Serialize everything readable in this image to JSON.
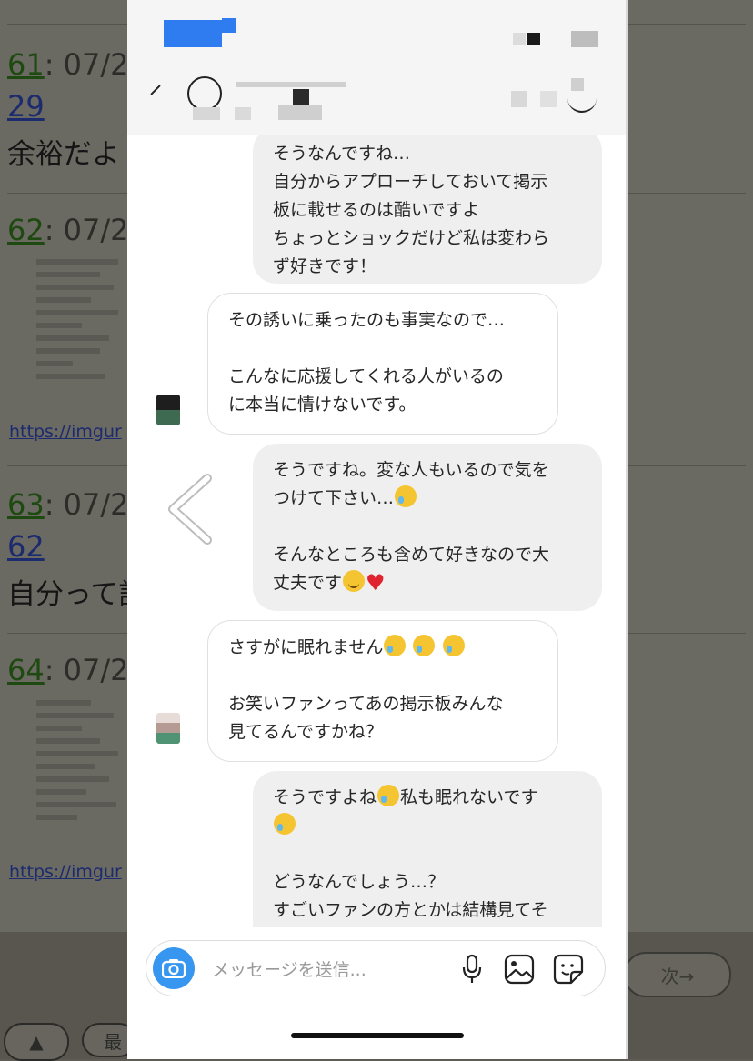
{
  "background": {
    "posts": [
      {
        "num": "61",
        "date": "07/2",
        "reply": "29",
        "text": "余裕だよ"
      },
      {
        "num": "62",
        "date": "07/2",
        "link": "https://imgur"
      },
      {
        "num": "63",
        "date": "07/2",
        "reply": "62",
        "text": "自分って記"
      },
      {
        "num": "64",
        "date": "07/2",
        "link": "https://imgur"
      }
    ],
    "footer": {
      "top_label": "▲",
      "latest_label": "最",
      "next_label": "次→"
    }
  },
  "chat": {
    "messages": [
      {
        "from": "me",
        "lines": [
          "そうなんですね…",
          "自分からアプローチしておいて掲示",
          "板に載せるのは酷いですよ",
          "ちょっとショックだけど私は変わら",
          "ず好きです！"
        ]
      },
      {
        "from": "them",
        "lines": [
          "その誘いに乗ったのも事実なので…",
          "",
          "こんなに応援してくれる人がいるの",
          "に本当に情けないです。"
        ]
      },
      {
        "from": "me",
        "lines": [
          "そうですね。変な人もいるので気を",
          "つけて下さい…",
          "",
          "そんなところも含めて好きなので大",
          "丈夫です"
        ]
      },
      {
        "from": "them",
        "lines": [
          "さすがに眠れません",
          "",
          "お笑いファンってあの掲示板みんな",
          "見てるんですかね？"
        ]
      },
      {
        "from": "me",
        "lines": [
          "そうですよね",
          "私も眠れないです",
          "",
          "どうなんでしょう…？",
          "すごいファンの方とかは結構見てそ"
        ]
      }
    ],
    "composer": {
      "placeholder": "メッセージを送信..."
    },
    "colors": {
      "accent": "#3797f0",
      "bubble_mine": "#efefef",
      "bubble_theirs": "#ffffff"
    },
    "icons": [
      "camera-icon",
      "microphone-icon",
      "gallery-icon",
      "sticker-icon",
      "back-chevron-icon"
    ]
  }
}
